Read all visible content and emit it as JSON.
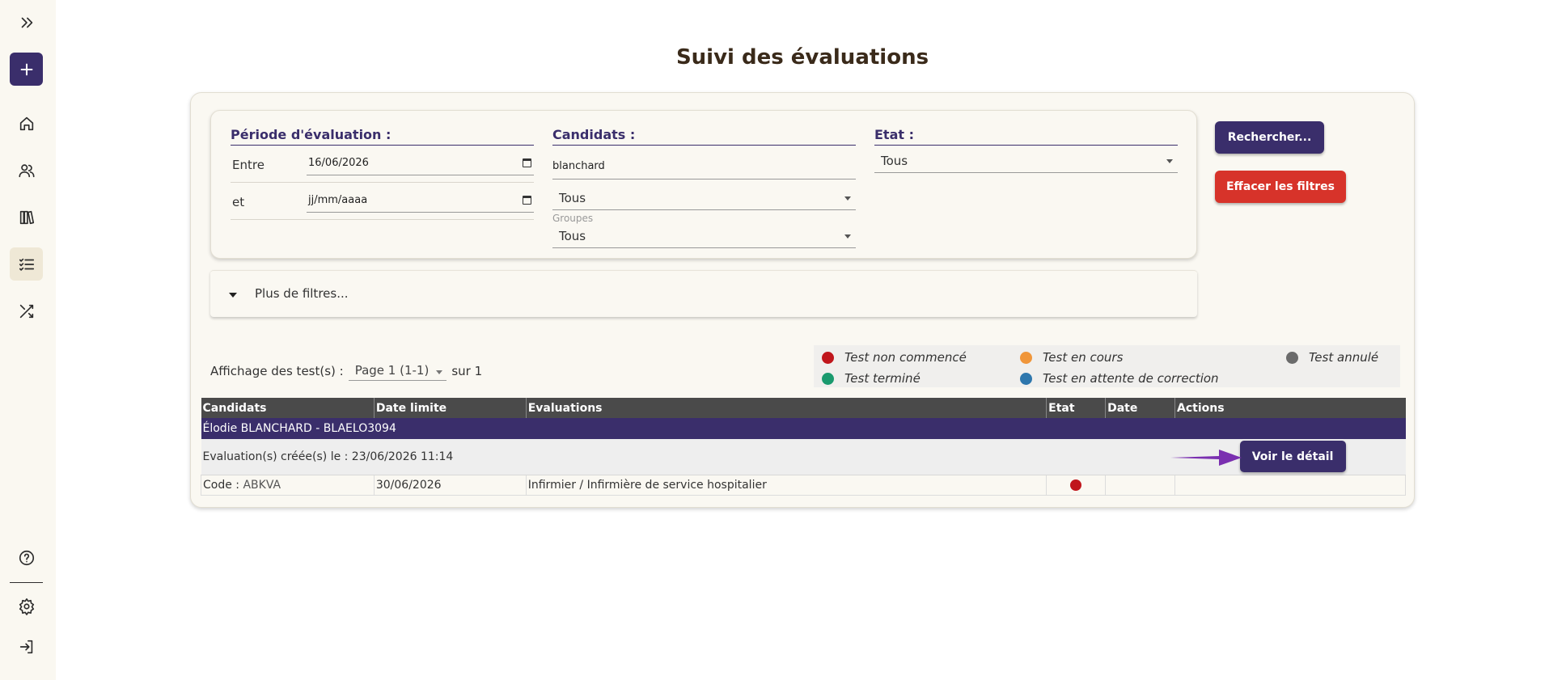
{
  "sidebar": {
    "items": [
      {
        "name": "expand",
        "icon": "double-chevron-right-icon"
      },
      {
        "name": "add",
        "icon": "plus-icon"
      },
      {
        "name": "home",
        "icon": "home-icon"
      },
      {
        "name": "users",
        "icon": "users-icon"
      },
      {
        "name": "library",
        "icon": "books-icon"
      },
      {
        "name": "evaluations",
        "icon": "checklist-icon"
      },
      {
        "name": "shuffle",
        "icon": "shuffle-icon"
      },
      {
        "name": "help",
        "icon": "help-circle-icon"
      },
      {
        "name": "settings",
        "icon": "gear-icon"
      },
      {
        "name": "logout",
        "icon": "logout-icon"
      }
    ]
  },
  "page": {
    "title": "Suivi des évaluations"
  },
  "filters": {
    "period": {
      "heading": "Période d'évaluation :",
      "between_label": "Entre",
      "between_value": "16/06/2026",
      "and_label": "et",
      "and_value": "jj/mm/aaaa"
    },
    "candidates": {
      "heading": "Candidats :",
      "search_value": "blanchard",
      "select_value": "Tous",
      "groups_label": "Groupes",
      "groups_value": "Tous"
    },
    "state": {
      "heading": "Etat :",
      "value": "Tous"
    },
    "search_button": "Rechercher...",
    "clear_button": "Effacer les filtres",
    "more_filters": "Plus de filtres..."
  },
  "pager": {
    "label": "Affichage des test(s) :",
    "page_value": "Page 1 (1-1)",
    "suffix": "sur 1"
  },
  "legend": [
    {
      "label": "Test non commencé",
      "color": "#c0161c"
    },
    {
      "label": "Test en cours",
      "color": "#f0963a"
    },
    {
      "label": "Test annulé",
      "color": "#6b6b6b"
    },
    {
      "label": "Test terminé",
      "color": "#1a9a6e"
    },
    {
      "label": "Test en attente de correction",
      "color": "#2e77ad"
    }
  ],
  "table": {
    "headers": [
      "Candidats",
      "Date limite",
      "Evaluations",
      "Etat",
      "Date",
      "Actions"
    ],
    "candidate": "Élodie BLANCHARD - BLAELO3094",
    "created": "Evaluation(s) créée(s) le : 23/06/2026 11:14",
    "detail_button": "Voir le détail",
    "row": {
      "code_label": "Code :",
      "code_value": "ABKVA",
      "deadline": "30/06/2026",
      "evaluation": "Infirmier / Infirmière de service hospitalier",
      "state_color": "#c0161c",
      "date": ""
    }
  },
  "colors": {
    "primary": "#3a2e6b",
    "danger": "#d7332a",
    "arrow": "#7a2fb0"
  }
}
